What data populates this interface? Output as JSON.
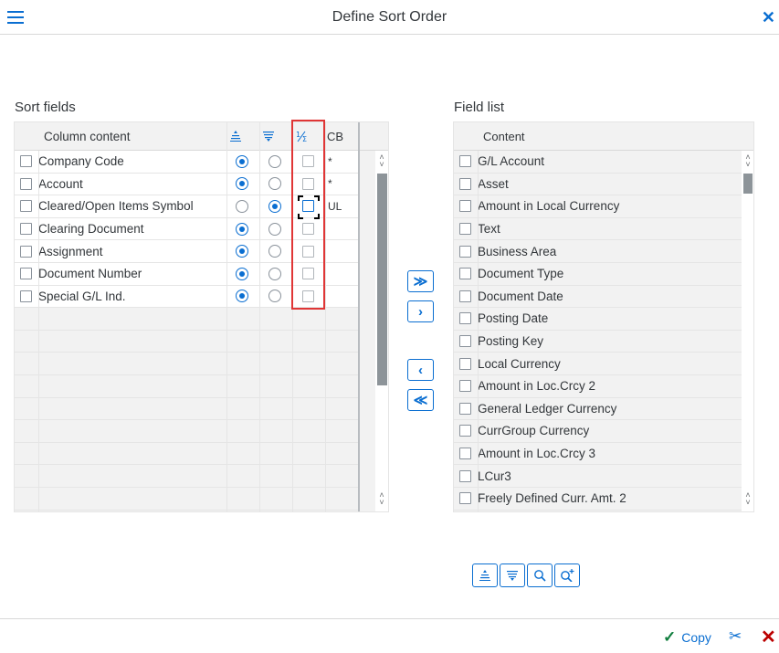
{
  "header": {
    "title": "Define Sort Order"
  },
  "sort_fields": {
    "title": "Sort fields",
    "columns": {
      "content": "Column content",
      "cb": "CB"
    },
    "rows": [
      {
        "label": "Company Code",
        "ascending": true,
        "cb": "*"
      },
      {
        "label": "Account",
        "ascending": true,
        "cb": "*"
      },
      {
        "label": "Cleared/Open Items Symbol",
        "ascending": false,
        "cb": "UL"
      },
      {
        "label": "Clearing Document",
        "ascending": true,
        "cb": ""
      },
      {
        "label": "Assignment",
        "ascending": true,
        "cb": ""
      },
      {
        "label": "Document Number",
        "ascending": true,
        "cb": ""
      },
      {
        "label": "Special G/L Ind.",
        "ascending": true,
        "cb": ""
      }
    ]
  },
  "field_list": {
    "title": "Field list",
    "column": "Content",
    "items": [
      "G/L Account",
      "Asset",
      "Amount in Local Currency",
      "Text",
      "Business Area",
      "Document Type",
      "Document Date",
      "Posting Date",
      "Posting Key",
      "Local Currency",
      "Amount in Loc.Crcy 2",
      "General Ledger Currency",
      "CurrGroup Currency",
      "Amount in Loc.Crcy 3",
      "LCur3",
      "Freely Defined Curr. Amt. 2"
    ]
  },
  "footer": {
    "copy_label": "Copy"
  },
  "icons": {
    "menu": "menu-icon",
    "close": "close-icon",
    "ascending": "sort-ascending-icon",
    "descending": "sort-descending-icon",
    "subtotal": "subtotal-icon",
    "copy": "check-icon",
    "cut": "scissors-icon",
    "cancel": "cancel-icon"
  },
  "colors": {
    "accent": "#0a6ed1",
    "highlight": "#e03636",
    "ok": "#107e3e",
    "cancel": "#bb0000"
  }
}
